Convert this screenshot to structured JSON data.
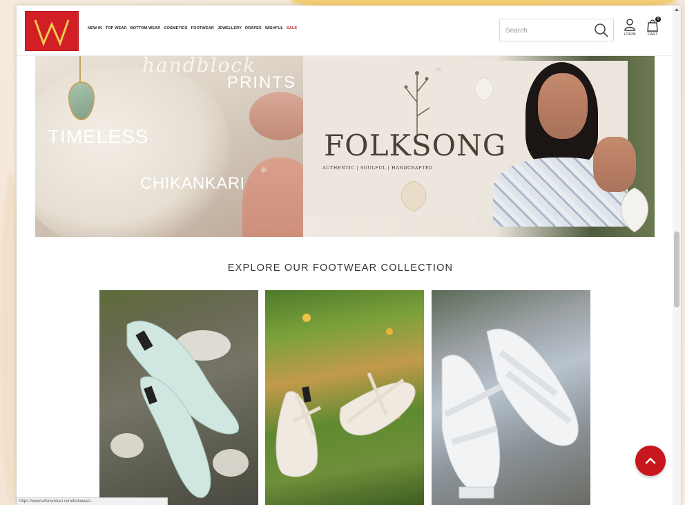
{
  "brand": {
    "logo_text": "W",
    "logo_color": "#d21f26"
  },
  "nav": {
    "items": [
      "NEW IN",
      "TOP WEAR",
      "BOTTOM WEAR",
      "COSMETICS",
      "FOOTWEAR",
      "JEWELLERY",
      "DRAPES",
      "WISHFUL",
      "SALE"
    ]
  },
  "search": {
    "placeholder": "Search",
    "icon": "search-icon"
  },
  "account": {
    "login_label": "LOGIN",
    "cart_label": "CART",
    "cart_count": "0"
  },
  "banner": {
    "left": {
      "script_text": "handblock",
      "prints_text": "PRINTS",
      "timeless_text": "TIMELESS",
      "chikankari_text": "CHIKANKARI"
    },
    "right": {
      "title": "FOLKSONG",
      "subtitle": "AUTHENTIC | SOULFUL | HANDCRAFTED"
    }
  },
  "section": {
    "title": "EXPLORE OUR FOOTWEAR COLLECTION"
  },
  "products": [
    {
      "alt": "Mint pointed mules on stone"
    },
    {
      "alt": "White strappy sandals on grass"
    },
    {
      "alt": "White block heel sandals"
    }
  ],
  "status_bar": {
    "url": "https://www.wforwoman.com/footwear/..."
  },
  "colors": {
    "accent": "#d21f26",
    "scroll_top": "#c7161d"
  }
}
